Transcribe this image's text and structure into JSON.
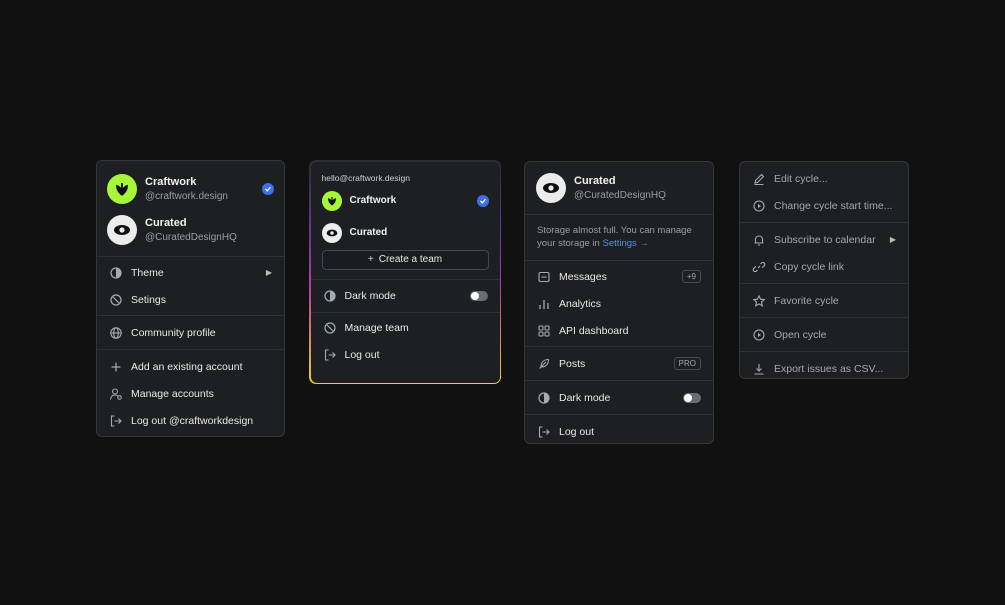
{
  "menu1": {
    "accounts": [
      {
        "name": "Craftwork",
        "handle": "@craftwork.design",
        "selected": true
      },
      {
        "name": "Curated",
        "handle": "@CuratedDesignHQ",
        "selected": false
      }
    ],
    "items": {
      "theme": "Theme",
      "settings": "Setings",
      "community": "Community profile",
      "add_account": "Add an existing account",
      "manage_accounts": "Manage accounts",
      "logout": "Log out @craftworkdesign"
    }
  },
  "menu2": {
    "email": "hello@craftwork.design",
    "accounts": [
      {
        "name": "Craftwork",
        "selected": true
      },
      {
        "name": "Curated",
        "selected": false
      }
    ],
    "create_team": "Create a team",
    "dark_mode": "Dark mode",
    "dark_mode_on": false,
    "manage_team": "Manage team",
    "logout": "Log out"
  },
  "menu3": {
    "account": {
      "name": "Curated",
      "handle": "@CuratedDesignHQ"
    },
    "storage_text": "Storage almost full. You can manage your storage in",
    "storage_link": "Settings →",
    "messages": "Messages",
    "messages_badge": "+9",
    "analytics": "Analytics",
    "api_dashboard": "API dashboard",
    "posts": "Posts",
    "posts_badge": "PRO",
    "dark_mode": "Dark mode",
    "dark_mode_on": false,
    "logout": "Log out"
  },
  "menu4": {
    "edit_cycle": "Edit cycle...",
    "change_start": "Change cycle start time...",
    "subscribe": "Subscribe to calendar",
    "copy_link": "Copy cycle link",
    "favorite": "Favorite cycle",
    "open": "Open cycle",
    "export": "Export issues as CSV..."
  },
  "colors": {
    "background": "#111112",
    "panel": "#1e1f22",
    "accent_blue": "#3f6ee8",
    "link_blue": "#5b8cf5",
    "craftwork_green": "#a6f63a"
  }
}
